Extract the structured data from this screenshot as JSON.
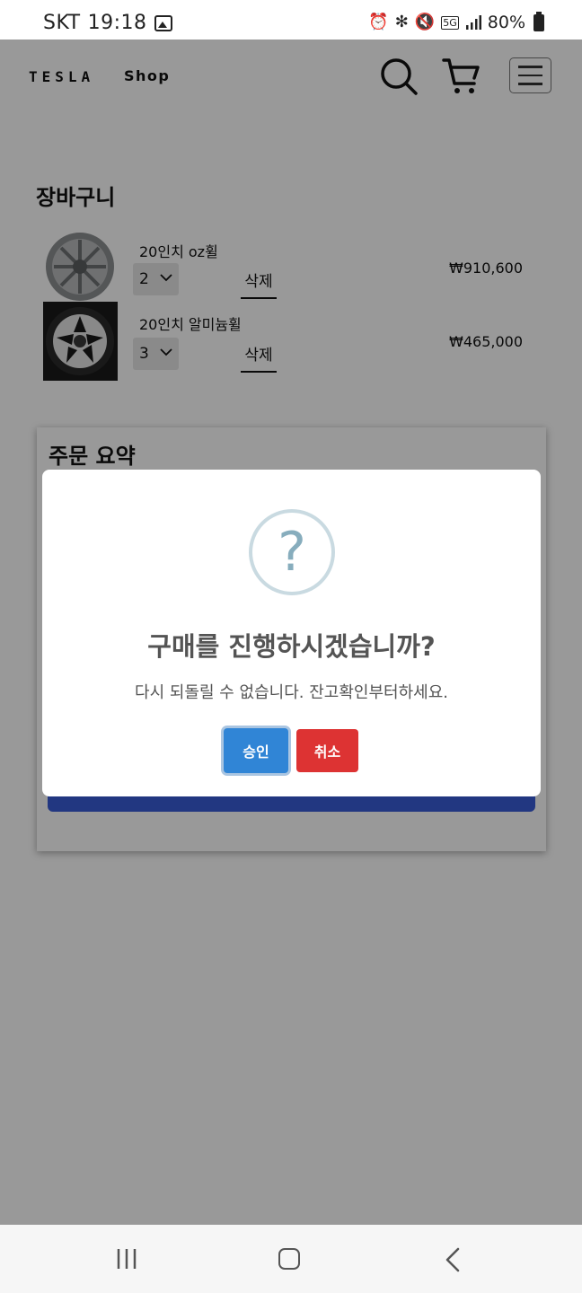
{
  "status_bar": {
    "carrier": "SKT",
    "time": "19:18",
    "network": "5G",
    "battery": "80%",
    "icons": [
      "image-icon",
      "alarm-icon",
      "bluetooth-icon",
      "mute-icon",
      "data-icon",
      "signal-icon",
      "battery-icon"
    ]
  },
  "header": {
    "logo": "TESLA",
    "shop_label": "Shop",
    "icons": [
      "search-icon",
      "cart-icon",
      "menu-icon"
    ]
  },
  "cart": {
    "title": "장바구니",
    "delete_label": "삭제",
    "items": [
      {
        "name": "20인치 oz휠",
        "quantity": "2",
        "price": "₩910,600"
      },
      {
        "name": "20인치 알미늄휠",
        "quantity": "3",
        "price": "₩465,000"
      }
    ]
  },
  "summary": {
    "title": "주문 요약"
  },
  "dialog": {
    "icon": "question-icon",
    "icon_glyph": "?",
    "title": "구매를 진행하시겠습니까?",
    "text": "다시 되돌릴 수 없습니다. 잔고확인부터하세요.",
    "confirm_label": "승인",
    "cancel_label": "취소",
    "colors": {
      "confirm": "#3085d6",
      "cancel": "#dd3333"
    }
  },
  "nav_bar": {
    "icons": [
      "recent-apps-icon",
      "home-icon",
      "back-icon"
    ]
  }
}
